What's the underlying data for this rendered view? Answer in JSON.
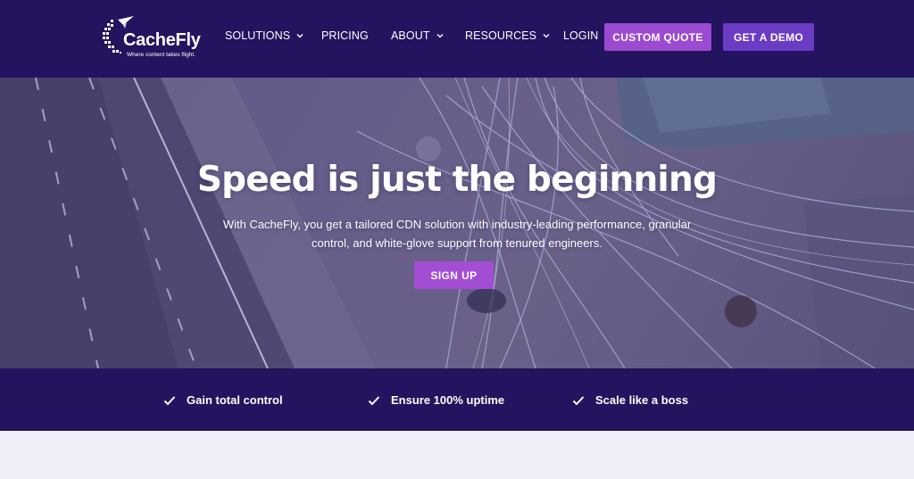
{
  "brand": {
    "name": "CacheFly",
    "tagline": "Where content takes flight."
  },
  "nav": {
    "items": [
      {
        "label": "SOLUTIONS",
        "has_dropdown": true
      },
      {
        "label": "PRICING",
        "has_dropdown": false
      },
      {
        "label": "ABOUT",
        "has_dropdown": true
      },
      {
        "label": "RESOURCES",
        "has_dropdown": true
      },
      {
        "label": "LOGIN",
        "has_dropdown": false
      }
    ],
    "custom_quote_label": "CUSTOM QUOTE",
    "demo_label": "GET A DEMO"
  },
  "hero": {
    "title": "Speed is just the beginning",
    "subtitle": "With CacheFly, you get a tailored CDN solution with industry-leading performance, granular control, and white-glove support from tenured engineers.",
    "cta_label": "SIGN UP"
  },
  "features": [
    {
      "label": "Gain total control",
      "icon": "check-icon"
    },
    {
      "label": "Ensure 100% uptime",
      "icon": "check-icon"
    },
    {
      "label": "Scale like a boss",
      "icon": "check-icon"
    }
  ],
  "colors": {
    "header_bg": "#24135e",
    "quote_button": "#9b4ad1",
    "demo_button": "#6a3cc4",
    "signup_button": "#a34dd4",
    "page_bg": "#f1eef9"
  }
}
